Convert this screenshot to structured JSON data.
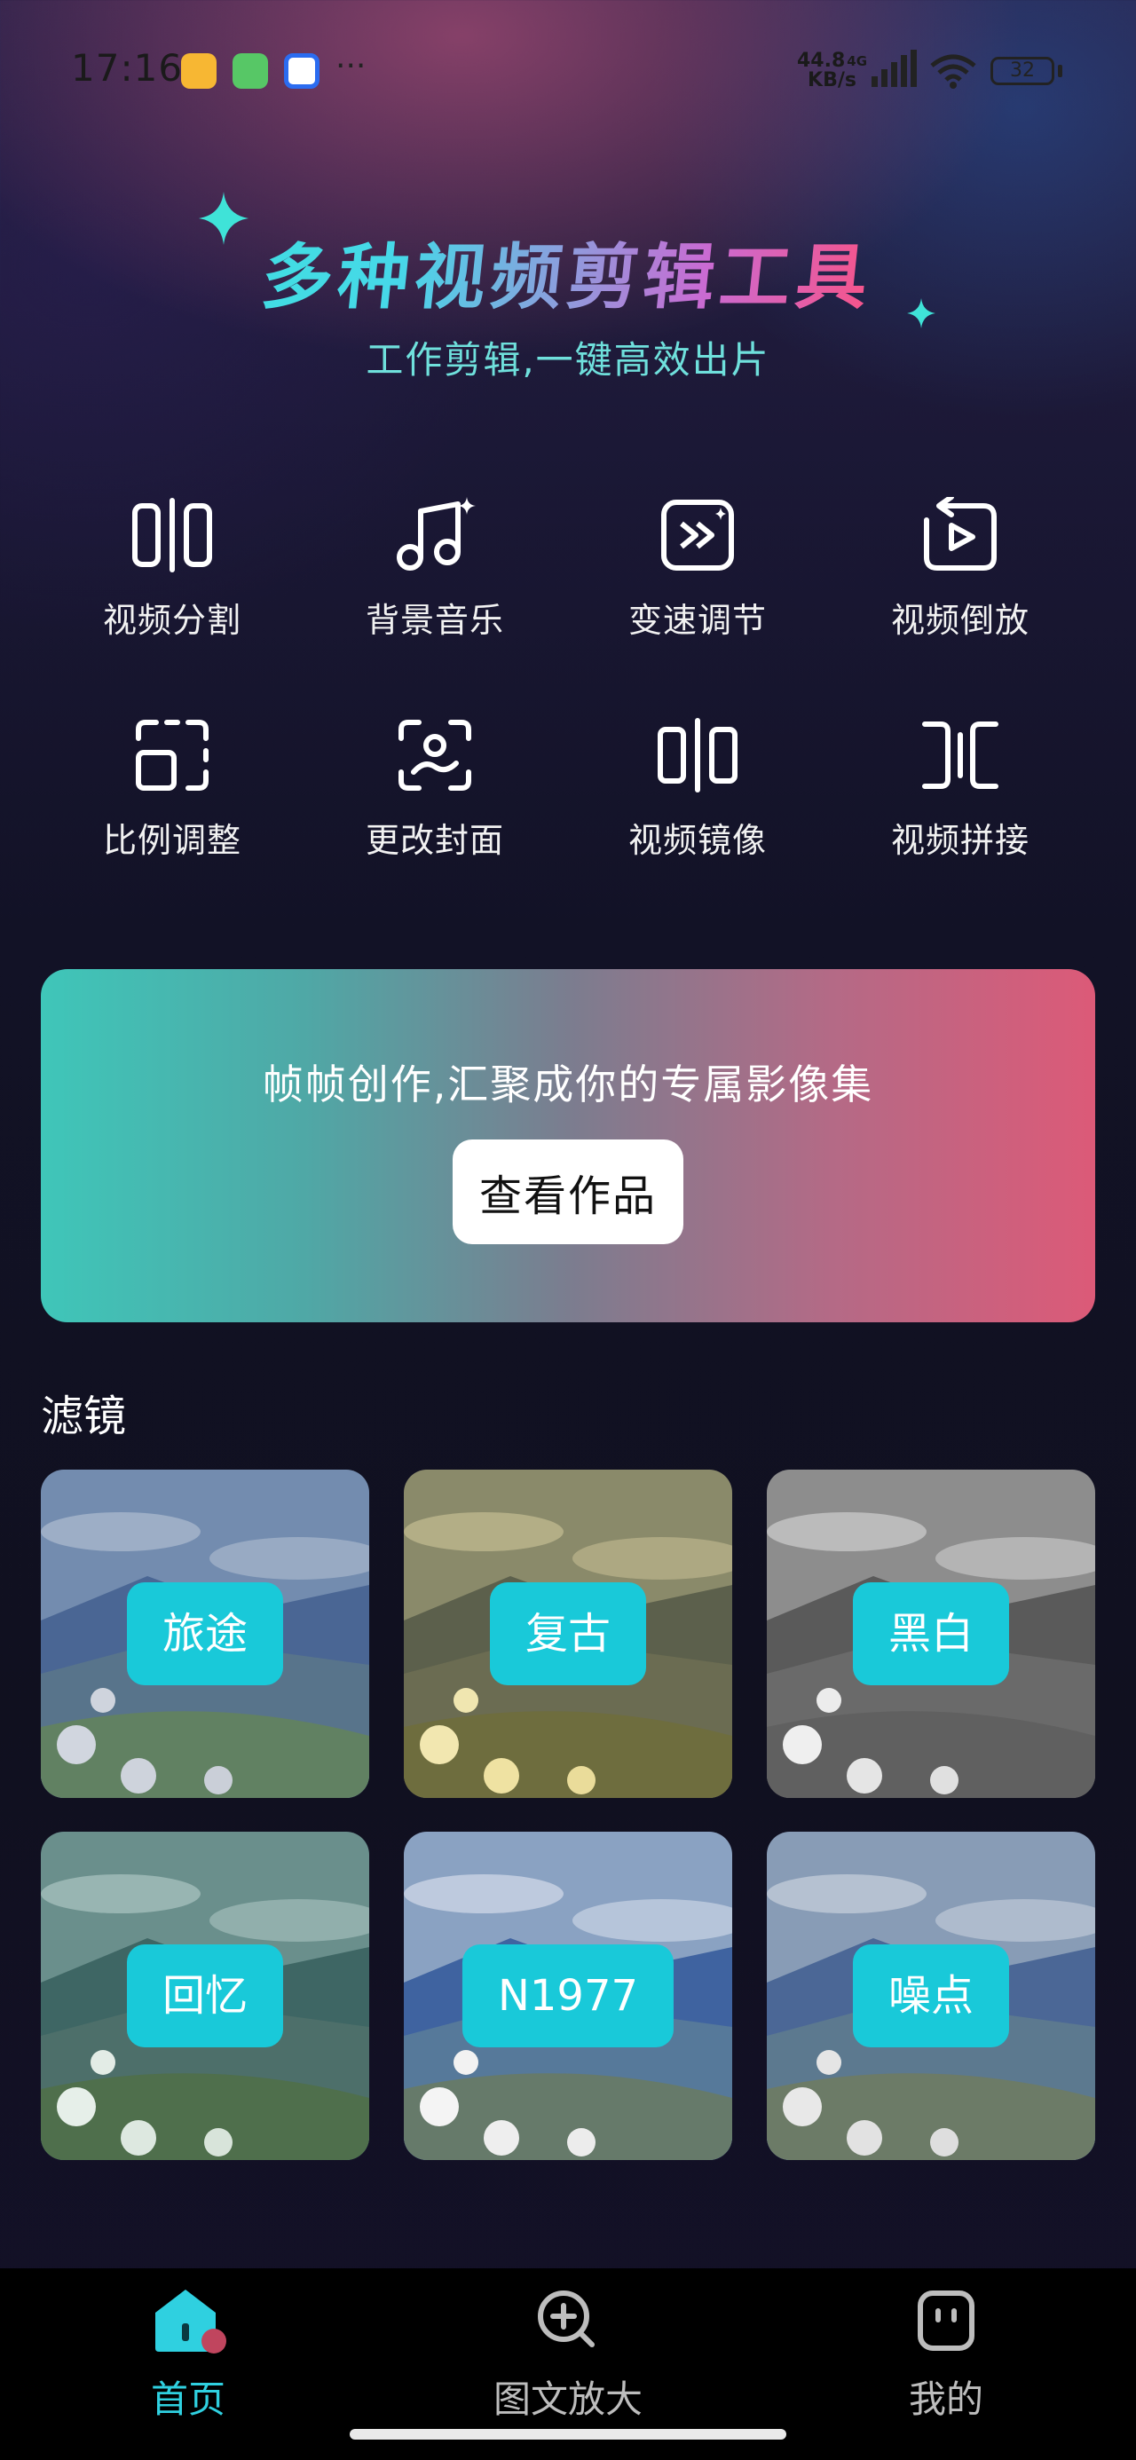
{
  "status_bar": {
    "time": "17:16",
    "net_speed": "44.8",
    "net_unit": "KB/s",
    "network_type": "4G",
    "battery": "32",
    "more": "···"
  },
  "hero": {
    "title": "多种视频剪辑工具",
    "subtitle": "工作剪辑,一键高效出片"
  },
  "tools": [
    {
      "label": "视频分割",
      "icon": "split-icon"
    },
    {
      "label": "背景音乐",
      "icon": "music-icon"
    },
    {
      "label": "变速调节",
      "icon": "speed-icon"
    },
    {
      "label": "视频倒放",
      "icon": "reverse-icon"
    },
    {
      "label": "比例调整",
      "icon": "crop-ratio-icon"
    },
    {
      "label": "更改封面",
      "icon": "cover-icon"
    },
    {
      "label": "视频镜像",
      "icon": "mirror-icon"
    },
    {
      "label": "视频拼接",
      "icon": "join-icon"
    }
  ],
  "banner": {
    "text": "帧帧创作,汇聚成你的专属影像集",
    "button": "查看作品"
  },
  "filters_section": {
    "title": "滤镜",
    "items": [
      {
        "label": "旅途"
      },
      {
        "label": "复古"
      },
      {
        "label": "黑白"
      },
      {
        "label": "回忆"
      },
      {
        "label": "N1977"
      },
      {
        "label": "噪点"
      }
    ]
  },
  "bottom_nav": {
    "items": [
      {
        "label": "首页",
        "icon": "home-icon",
        "active": true
      },
      {
        "label": "图文放大",
        "icon": "zoom-in-icon",
        "active": false
      },
      {
        "label": "我的",
        "icon": "profile-icon",
        "active": false
      }
    ]
  },
  "colors": {
    "accent": "#19c9d9",
    "nav_active": "#2fd0e0",
    "nav_inactive": "#bdbdbd"
  }
}
